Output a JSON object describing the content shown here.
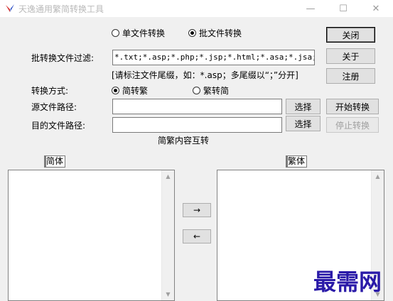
{
  "window": {
    "title": "天逸通用繁简转换工具",
    "controls": {
      "minimize": "—",
      "maximize": "☐",
      "close": "✕"
    }
  },
  "mode": {
    "single_label": "单文件转换",
    "batch_label": "批文件转换",
    "selected": "batch"
  },
  "filter": {
    "label": "批转换文件过滤:",
    "value": "*.txt;*.asp;*.php;*.jsp;*.html;*.asa;*.jsa;*.vb",
    "hint": "[请标注文件尾缀，如：*.asp；多尾缀以“；”分开]"
  },
  "conversion": {
    "label": "转换方式:",
    "s2t_label": "简转繁",
    "t2s_label": "繁转简",
    "selected": "s2t"
  },
  "source": {
    "label": "源文件路径:",
    "value": "",
    "browse_label": "选择"
  },
  "target": {
    "label": "目的文件路径:",
    "value": "",
    "browse_label": "选择"
  },
  "buttons": {
    "close": "关闭",
    "about": "关于",
    "register": "注册",
    "start": "开始转换",
    "stop": "停止转换"
  },
  "interconvert": {
    "title": "简繁内容互转",
    "simplified_label": "简体",
    "traditional_label": "繁体",
    "to_right": "→",
    "to_left": "←"
  },
  "watermark": "最需网",
  "colors": {
    "icon_red": "#d32f2f",
    "icon_blue": "#1a3fbf",
    "watermark": "#2a1aa8"
  }
}
